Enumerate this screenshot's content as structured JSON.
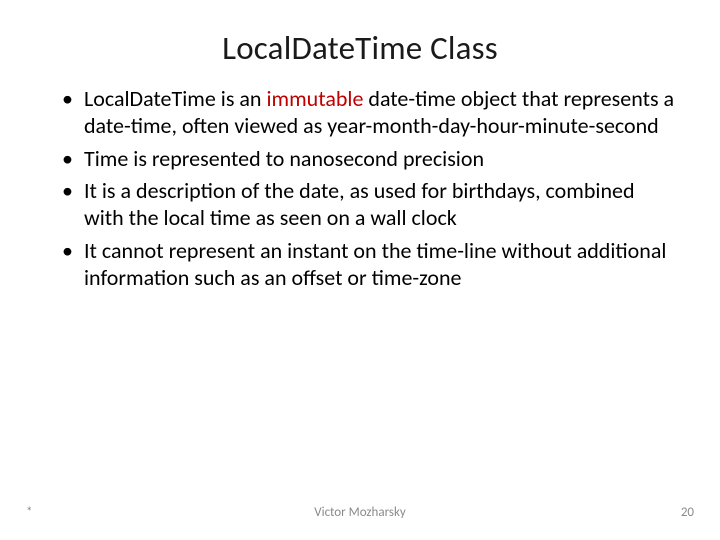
{
  "slide": {
    "title": "LocalDateTime Class",
    "bullets": [
      {
        "pre": "LocalDateTime is an ",
        "highlight": "immutable",
        "post": " date-time object that represents a date-time, often viewed as year-month-day-hour-minute-second"
      },
      {
        "pre": "Time is represented to nanosecond precision",
        "highlight": "",
        "post": ""
      },
      {
        "pre": "It is a description of the date, as used for birthdays, combined with the local time as seen on a wall clock",
        "highlight": "",
        "post": ""
      },
      {
        "pre": "It cannot represent an instant on the time-line without additional information such as an offset or time-zone",
        "highlight": "",
        "post": ""
      }
    ],
    "footer": {
      "star": "*",
      "author": "Victor Mozharsky",
      "page": "20"
    }
  }
}
